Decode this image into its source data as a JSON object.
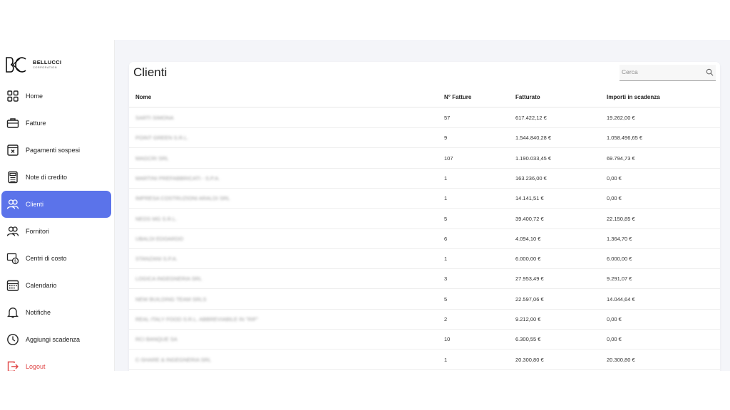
{
  "brand": {
    "name": "BELLUCCI",
    "tagline": "CORPORATION"
  },
  "sidebar": {
    "items": [
      {
        "label": "Home",
        "icon": "grid-icon"
      },
      {
        "label": "Fatture",
        "icon": "briefcase-icon"
      },
      {
        "label": "Pagamenti sospesi",
        "icon": "document-x-icon"
      },
      {
        "label": "Note di credito",
        "icon": "calculator-icon"
      },
      {
        "label": "Clienti",
        "icon": "users-icon",
        "active": true
      },
      {
        "label": "Fornitori",
        "icon": "users-icon"
      },
      {
        "label": "Centri di costo",
        "icon": "money-icon"
      },
      {
        "label": "Calendario",
        "icon": "calendar-icon"
      },
      {
        "label": "Notifiche",
        "icon": "bell-icon"
      },
      {
        "label": "Aggiungi scadenza",
        "icon": "clock-icon"
      },
      {
        "label": "Logout",
        "icon": "logout-icon"
      }
    ]
  },
  "main": {
    "title": "Clienti",
    "search": {
      "placeholder": "Cerca"
    },
    "table": {
      "columns": [
        "Nome",
        "N° Fatture",
        "Fatturato",
        "Importi in scadenza"
      ],
      "rows": [
        {
          "name": "SARTI SIMONA",
          "fatture": "57",
          "fatturato": "617.422,12 €",
          "importi": "19.262,00 €"
        },
        {
          "name": "POINT GREEN S.R.L.",
          "fatture": "9",
          "fatturato": "1.544.840,28 €",
          "importi": "1.058.496,65 €"
        },
        {
          "name": "MAGCRI SRL",
          "fatture": "107",
          "fatturato": "1.190.033,45 €",
          "importi": "69.794,73 €"
        },
        {
          "name": "MARTINI PREFABBRICATI - S.P.A.",
          "fatture": "1",
          "fatturato": "163.236,00 €",
          "importi": "0,00 €"
        },
        {
          "name": "IMPRESA COSTRUZIONI ARALDI SRL",
          "fatture": "1",
          "fatturato": "14.141,51 €",
          "importi": "0,00 €"
        },
        {
          "name": "NEOS MG S.R.L.",
          "fatture": "5",
          "fatturato": "39.400,72 €",
          "importi": "22.150,85 €"
        },
        {
          "name": "UBALDI EDOARDO",
          "fatture": "6",
          "fatturato": "4.094,10 €",
          "importi": "1.364,70 €"
        },
        {
          "name": "STANZANI S.P.A.",
          "fatture": "1",
          "fatturato": "6.000,00 €",
          "importi": "6.000,00 €"
        },
        {
          "name": "LOGICA INGEGNERIA SRL",
          "fatture": "3",
          "fatturato": "27.953,49 €",
          "importi": "9.291,07 €"
        },
        {
          "name": "NEW BUILDING TEAM SRLS",
          "fatture": "5",
          "fatturato": "22.597,06 €",
          "importi": "14.044,64 €"
        },
        {
          "name": "REAL ITALY FOOD S.R.L. ABBREVIABILE IN \"RIF\"",
          "fatture": "2",
          "fatturato": "9.212,00 €",
          "importi": "0,00 €"
        },
        {
          "name": "RCI BANQUE SA",
          "fatture": "10",
          "fatturato": "6.300,55 €",
          "importi": "0,00 €"
        },
        {
          "name": "C-SHARE & INGEGNERIA SRL",
          "fatture": "1",
          "fatturato": "20.300,80 €",
          "importi": "20.300,80 €"
        }
      ]
    }
  },
  "colors": {
    "accent": "#5b73ea",
    "logout": "#e04646",
    "background": "#f4f5f9"
  }
}
